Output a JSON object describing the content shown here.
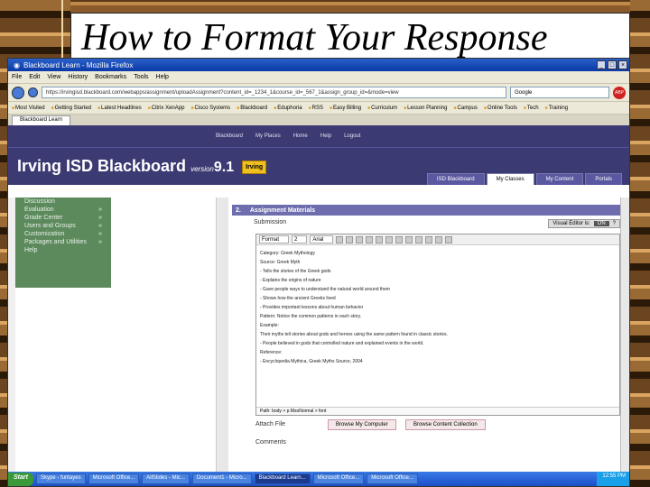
{
  "slide": {
    "title": "How to Format Your Response"
  },
  "browser": {
    "window_title": "Blackboard Learn - Mozilla Firefox",
    "menus": [
      "File",
      "Edit",
      "View",
      "History",
      "Bookmarks",
      "Tools",
      "Help"
    ],
    "url": "https://irvingisd.blackboard.com/webapps/assignment/uploadAssignment?content_id=_1234_1&course_id=_567_1&assign_group_id=&mode=view",
    "search_placeholder": "Google",
    "bookmarks": [
      "Most Visited",
      "Getting Started",
      "Latest Headlines",
      "Citrix XenApp",
      "Cisco Systems",
      "Blackboard",
      "Eduphoria",
      "RSS",
      "Easy Billing",
      "Curriculum",
      "Lesson Planning",
      "Campus",
      "Online Tools",
      "Tech",
      "Training"
    ],
    "tab": "Blackboard Learn"
  },
  "bb": {
    "top_links": [
      "Blackboard",
      "My Places",
      "Home",
      "Help",
      "Logout"
    ],
    "logo_main": "Irving ISD Blackboard",
    "logo_version_label": "version",
    "logo_version": "9.1",
    "logo_badge": "Irving",
    "tabs": [
      "ISD Blackboard",
      "My Classes",
      "My Content",
      "Portals"
    ],
    "active_tab": 1
  },
  "sidebar": {
    "items": [
      "Discussion",
      "Evaluation",
      "Grade Center",
      "Users and Groups",
      "Customization",
      "Packages and Utilities",
      "Help"
    ]
  },
  "assignment": {
    "section_num": "2.",
    "section_title": "Assignment Materials",
    "submission_label": "Submission",
    "visual_editor_label": "Visual Editor is:",
    "visual_editor_state": "ON",
    "font_name": "Arial",
    "font_size": "2",
    "format_block": "Format",
    "body_lines": [
      "Category: Greek Mythology",
      "Source: Greek Myth",
      "- Tells the stories of the Greek gods",
      "- Explains the origins of nature",
      "- Gave people ways to understand the natural world around them",
      "- Shows how the ancient Greeks lived",
      "- Provides important lessons about human behavior",
      "Pattern: Notice the common patterns in each story.",
      "Example:",
      "Their myths tell stories about gods and heroes using the same pattern found in classic stories.",
      "- People believed in gods that controlled nature and explained events in the world.",
      "Reference:",
      "- Encyclopedia Mythica, Greek Myths Source, 2004"
    ],
    "editor_path": "Path: body > p.MsoNormal > font",
    "attach_label": "Attach File",
    "btn_browse": "Browse My Computer",
    "btn_content": "Browse Content Collection",
    "comments_label": "Comments"
  },
  "taskbar": {
    "start": "Start",
    "buttons": [
      "Skype - funtayes",
      "Microsoft Office...",
      "AllSlides - Mic...",
      "Document1 - Micro...",
      "Blackboard Learn...",
      "Microsoft Office...",
      "Microsoft Office..."
    ],
    "active_index": 4,
    "clock": "12:55 PM"
  }
}
